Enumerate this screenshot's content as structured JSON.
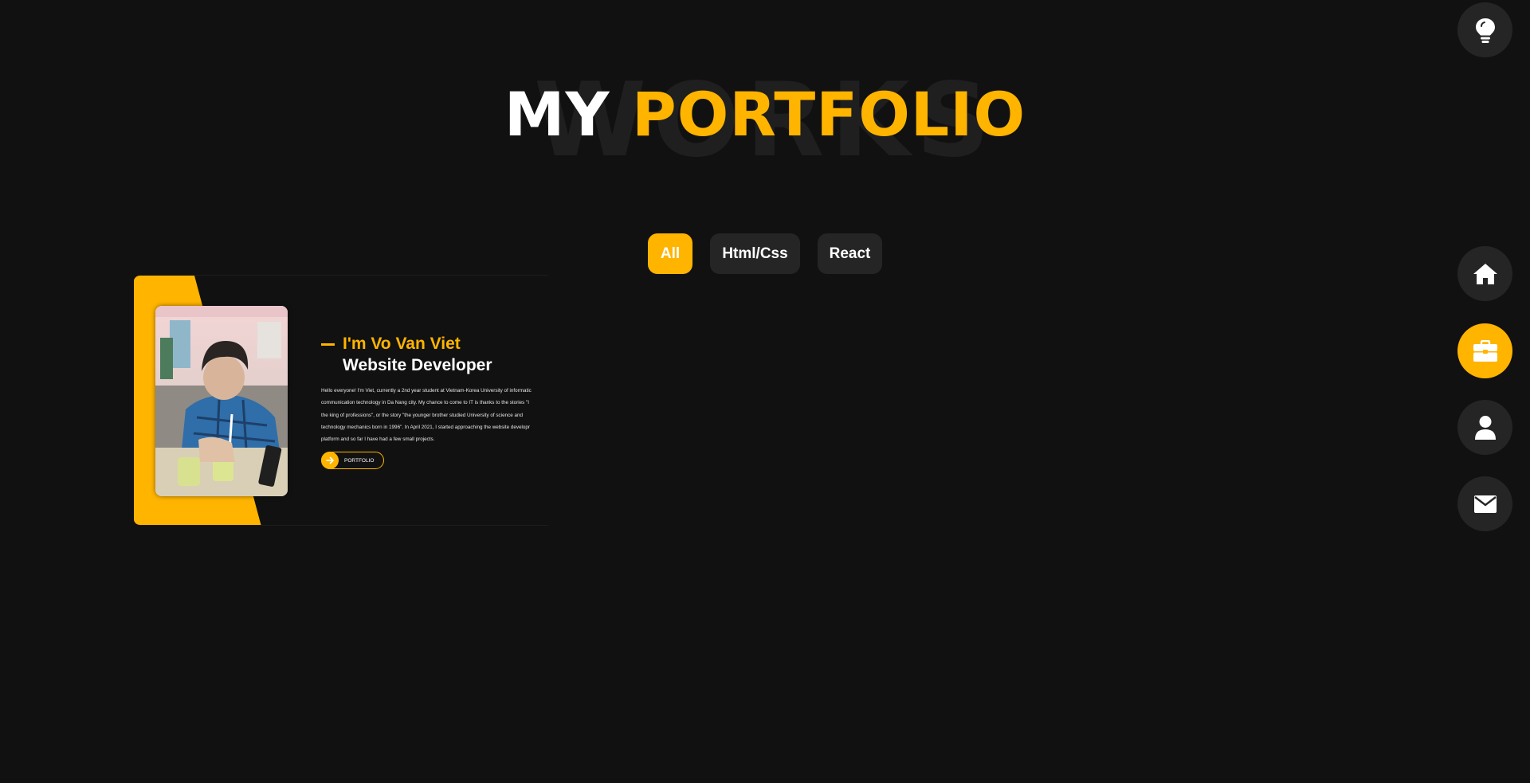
{
  "heading": {
    "background_word": "WORKS",
    "title_white": "MY",
    "title_accent": "PORTFOLIO"
  },
  "filters": [
    {
      "label": "All",
      "active": true
    },
    {
      "label": "Html/Css",
      "active": false
    },
    {
      "label": "React",
      "active": false
    }
  ],
  "card": {
    "greeting": "I'm Vo Van Viet",
    "role": "Website Developer",
    "description_lines": [
      "Hello everyone! I'm Viet, currently a 2nd year student at Vietnam-Korea University of informatic",
      "communication technology in Da Nang city. My chance to come to IT is thanks to the stories \"I",
      "the king of professions\", or the story \"the younger brother studied University of science and",
      "technology mechanics born in 1996\". In April 2021, I started approaching the website developr",
      "platform and so far I have had a few small projects."
    ],
    "button_label": "PORTFOLIO",
    "photo": "portrait-photo"
  },
  "nav": {
    "theme_icon": "lightbulb-icon",
    "items": [
      {
        "name": "home",
        "icon": "home-icon",
        "active": false
      },
      {
        "name": "portfolio",
        "icon": "briefcase-icon",
        "active": true
      },
      {
        "name": "about",
        "icon": "user-icon",
        "active": false
      },
      {
        "name": "contact",
        "icon": "envelope-icon",
        "active": false
      }
    ]
  },
  "colors": {
    "accent": "#ffb400",
    "background": "#111111",
    "surface": "#252525"
  }
}
